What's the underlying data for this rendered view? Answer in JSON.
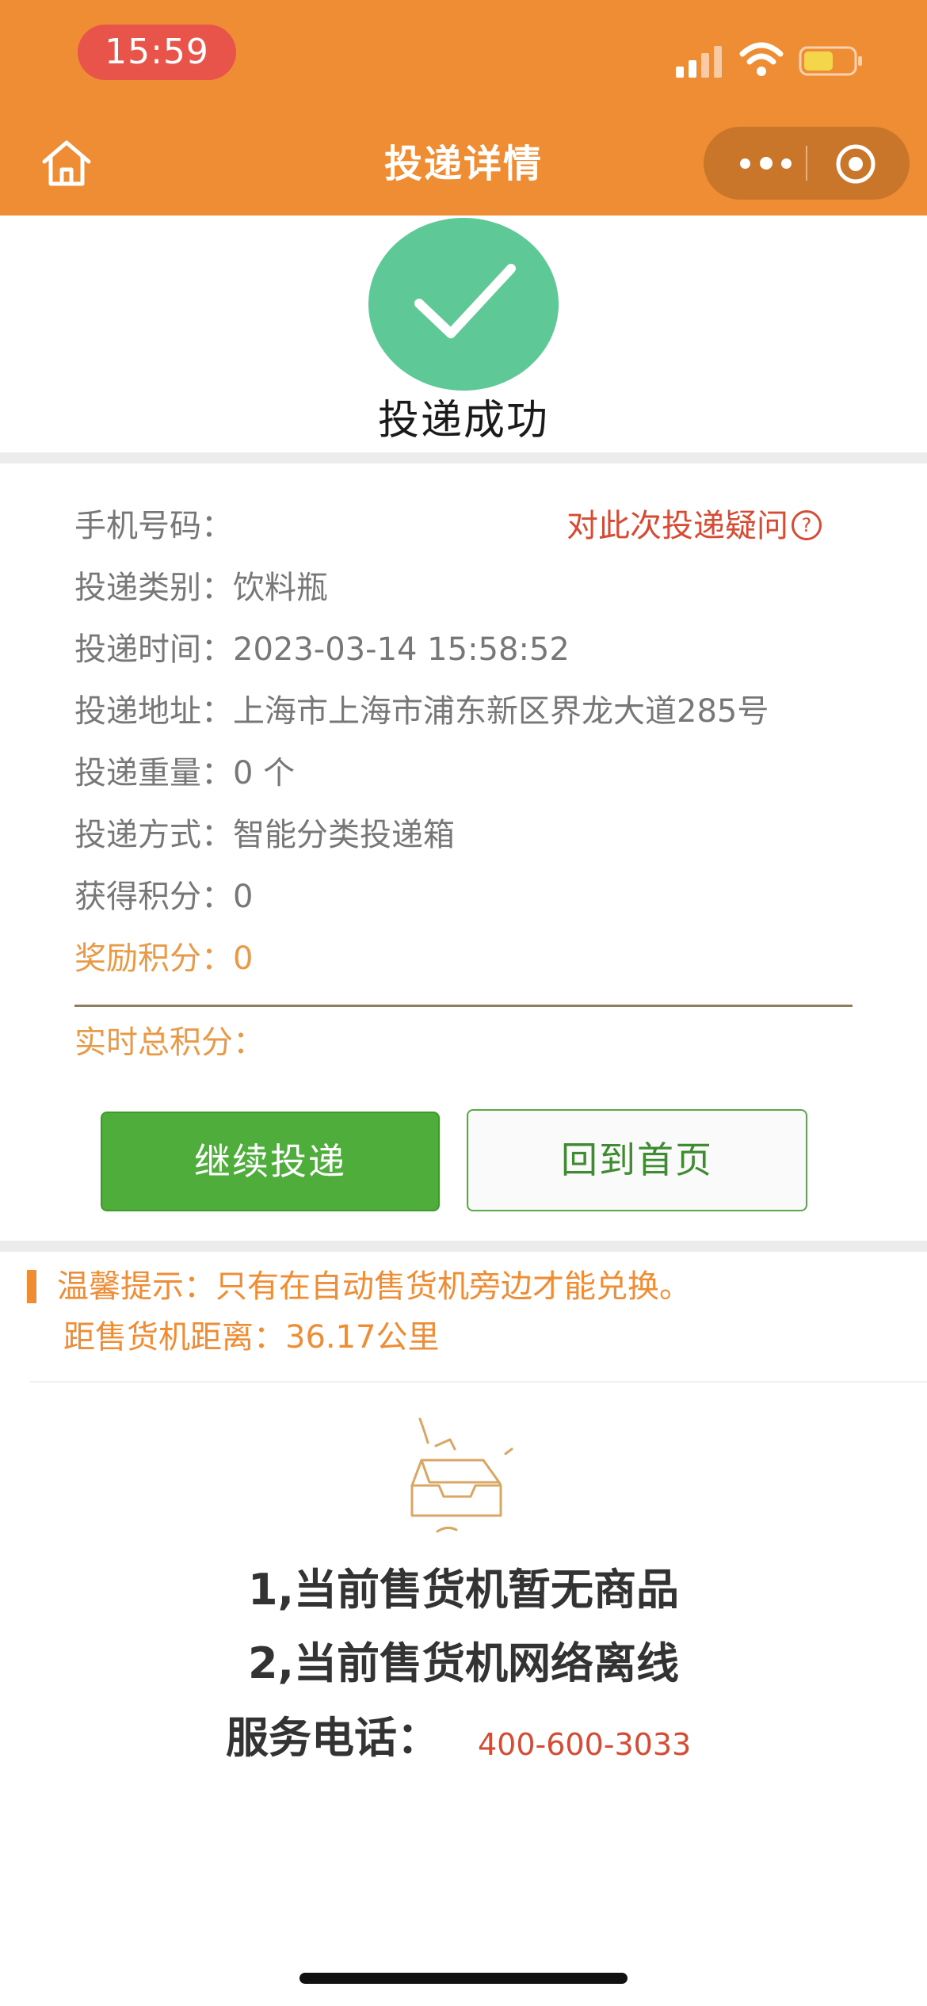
{
  "status_bar": {
    "time": "15:59"
  },
  "nav": {
    "title": "投递详情",
    "home_icon": "home-icon",
    "more_icon": "more-dots-icon",
    "close_icon": "target-circle-icon"
  },
  "result": {
    "icon": "check-icon",
    "text": "投递成功"
  },
  "details": {
    "phone_label": "手机号码：",
    "question_link": "对此次投递疑问",
    "category_label": "投递类别：",
    "category_value": "饮料瓶",
    "time_label": "投递时间：",
    "time_value": "2023-03-14 15:58:52",
    "address_label": "投递地址：",
    "address_value": "上海市上海市浦东新区界龙大道285号",
    "weight_label": "投递重量：",
    "weight_value": "0 个",
    "method_label": "投递方式：",
    "method_value": "智能分类投递箱",
    "points_label": "获得积分：",
    "points_value": "0",
    "bonus_label": "奖励积分：",
    "bonus_value": "0",
    "total_label": "实时总积分："
  },
  "buttons": {
    "continue": "继续投递",
    "home": "回到首页"
  },
  "tip": {
    "text": "温馨提示：只有在自动售货机旁边才能兑换。",
    "distance": "距售货机距离：36.17公里"
  },
  "notice": {
    "line1": "1,当前售货机暂无商品",
    "line2": "2,当前售货机网络离线",
    "service_label": "服务电话：",
    "service_phone": "400-600-3033"
  },
  "colors": {
    "header": "#ef8d35",
    "success": "#5ec896",
    "continue_button": "#4fad3c",
    "link_red": "#d64b33",
    "orange_text": "#e89a46"
  }
}
